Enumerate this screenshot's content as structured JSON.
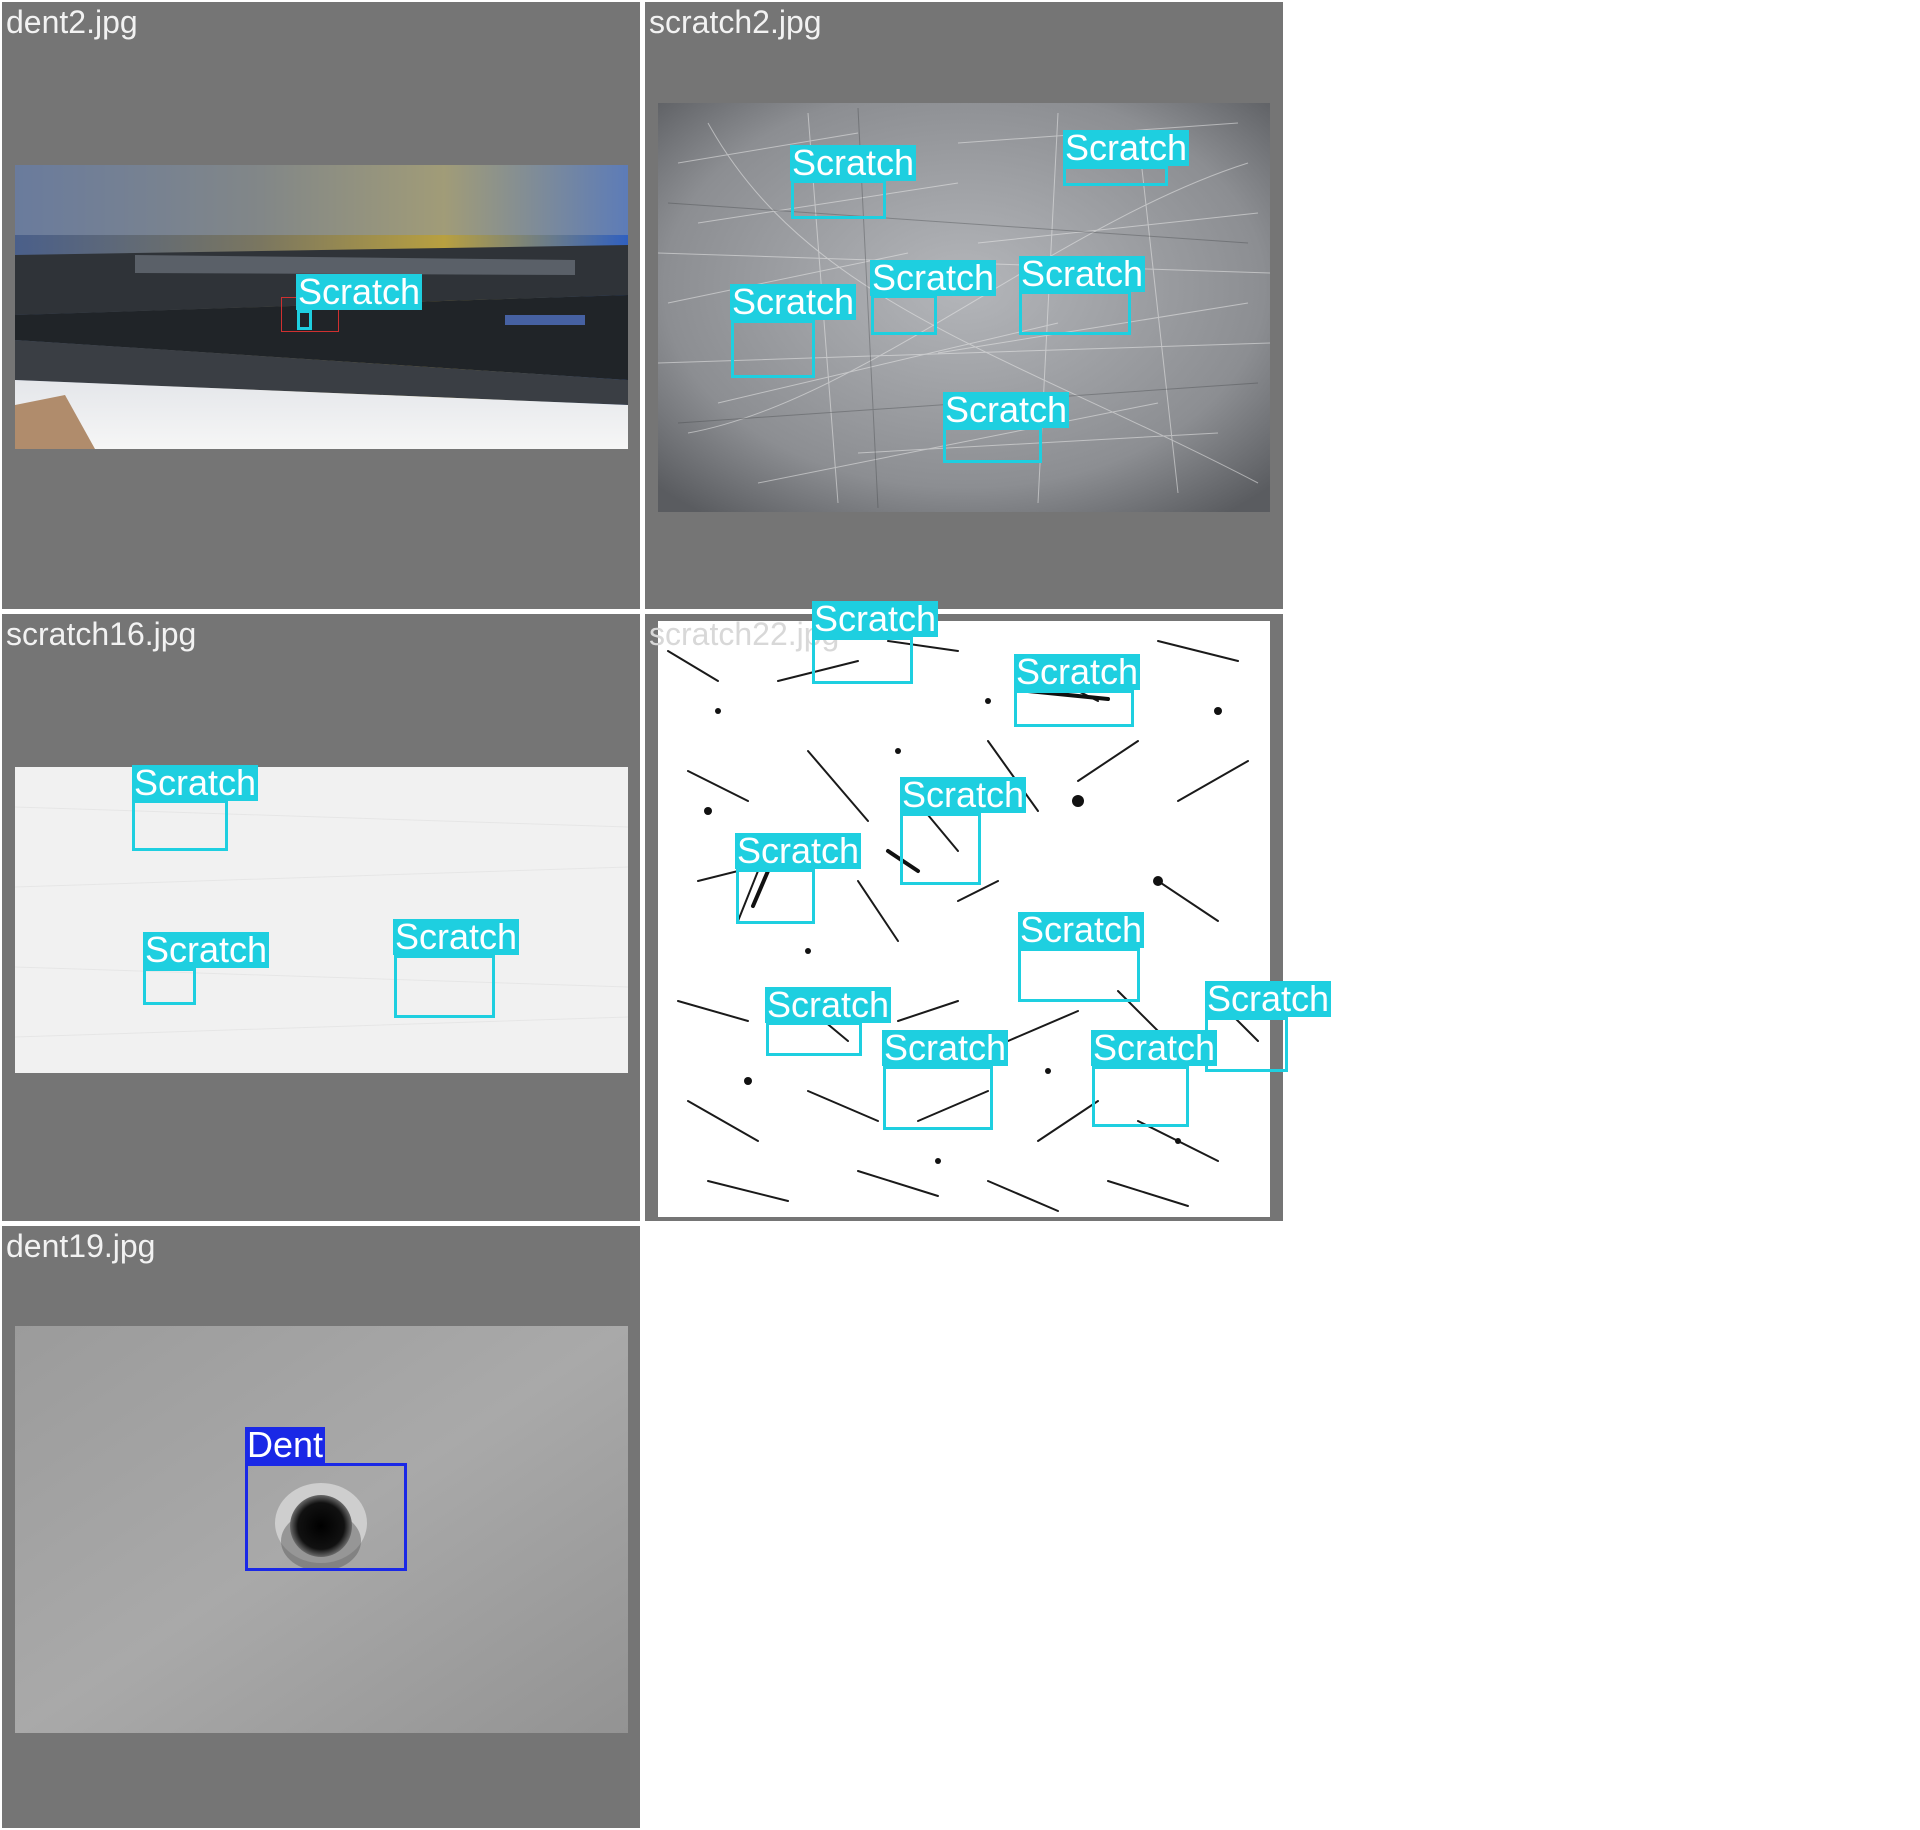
{
  "colors": {
    "cell_background": "#757575",
    "scratch": "#1ecfe0",
    "dent": "#1a28e6",
    "filename_text": "#f2f2f2"
  },
  "cells": [
    {
      "filename": "dent2.jpg",
      "detections": [
        {
          "label": "Scratch"
        }
      ]
    },
    {
      "filename": "scratch2.jpg",
      "detections": [
        {
          "label": "Scratch"
        },
        {
          "label": "Scratch"
        },
        {
          "label": "Scratch"
        },
        {
          "label": "Scratch"
        },
        {
          "label": "Scratch"
        },
        {
          "label": "Scratch"
        }
      ]
    },
    {
      "filename": "scratch16.jpg",
      "detections": [
        {
          "label": "Scratch"
        },
        {
          "label": "Scratch"
        },
        {
          "label": "Scratch"
        }
      ]
    },
    {
      "filename": "scratch22.jpg",
      "detections": [
        {
          "label": "Scratch"
        },
        {
          "label": "Scratch"
        },
        {
          "label": "Scratch"
        },
        {
          "label": "Scratch"
        },
        {
          "label": "Scratch"
        },
        {
          "label": "Scratch"
        },
        {
          "label": "Scratch"
        },
        {
          "label": "Scratch"
        },
        {
          "label": "Scratch"
        }
      ]
    },
    {
      "filename": "dent19.jpg",
      "detections": [
        {
          "label": "Dent"
        }
      ]
    }
  ]
}
